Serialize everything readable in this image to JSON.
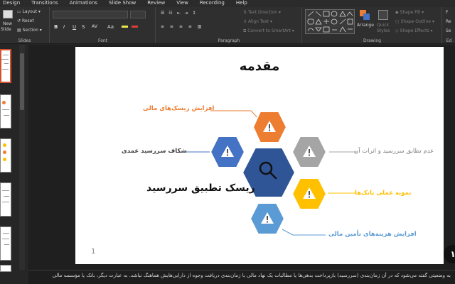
{
  "menu": [
    "Design",
    "Transitions",
    "Animations",
    "Slide Show",
    "Review",
    "View",
    "Recording",
    "Help"
  ],
  "ribbon": {
    "slides": {
      "label": "Slides",
      "new_slide": "New",
      "new_slide2": "Slide",
      "layout": "Layout",
      "reset": "Reset",
      "section": "Section"
    },
    "font": {
      "label": "Font",
      "bold": "B",
      "italic": "I",
      "underline": "U",
      "strike": "S",
      "spacing": "AV",
      "case": "Aa"
    },
    "paragraph": {
      "label": "Paragraph",
      "text_direction": "Text Direction",
      "align_text": "Align Text",
      "smartart": "Convert to SmartArt"
    },
    "drawing": {
      "label": "Drawing",
      "arrange": "Arrange",
      "quick": "Quick",
      "styles": "Styles",
      "shape_fill": "Shape Fill",
      "shape_outline": "Shape Outline",
      "shape_effects": "Shape Effects"
    },
    "right": {
      "item1": "F",
      "item2": "Re",
      "item3": "Se",
      "label": "Ed"
    }
  },
  "slide": {
    "title": "مقدمه",
    "number": "1",
    "center_label": "ریسک تطبیق سررسید",
    "labels": {
      "top_left": "افزایش ریسک‌های مالی",
      "left": "شکاف سررسید عمدی",
      "right_top": "عدم تطابق سررسید و اثرات آن",
      "right_bottom": "نمونه عملی بانک‌ها",
      "bottom": "افزایش هزینه‌های تأمین مالی"
    }
  },
  "badge": "۱",
  "notes": "به وضعیتی گفته می‌شود که در آن زمان‌بندی (سررسید) بازپرداخت بدهی‌ها یا مطالبات یک نهاد مالی با زمان‌بندی دریافت وجوه از دارایی‌هایش هماهنگ نباشد. به عبارت دیگر، بانک یا مؤسسه مالی",
  "colors": {
    "orange": "#ED7D31",
    "blue": "#4472C4",
    "gray": "#A5A5A5",
    "yellow": "#FFC000",
    "light_blue": "#5B9BD5",
    "dark_blue": "#2F5597",
    "accent": "#D35230"
  },
  "icons": {
    "hex": "warning-icon",
    "center": "search-icon"
  }
}
